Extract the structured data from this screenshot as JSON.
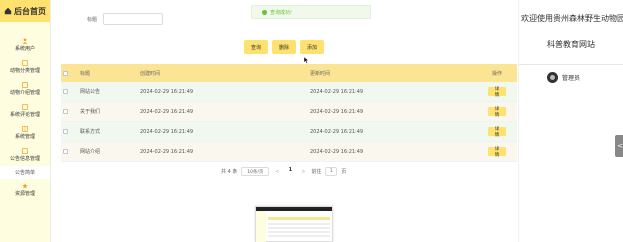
{
  "sidebar": {
    "brand": "后台首页",
    "items": [
      {
        "label": "系统用户",
        "icon": "user-icon"
      },
      {
        "label": "动物分类管理",
        "icon": "edit-icon"
      },
      {
        "label": "动物介绍管理",
        "icon": "edit-icon"
      },
      {
        "label": "系统评论管理",
        "icon": "edit-icon"
      },
      {
        "label": "系统管理",
        "icon": "grid-icon"
      },
      {
        "label": "公告信息管理",
        "icon": "edit-icon"
      }
    ],
    "sub_item": "公告简单",
    "last_item": {
      "label": "资源管理",
      "icon": "star-icon"
    }
  },
  "search": {
    "label": "标题",
    "value": ""
  },
  "toast": {
    "message": "查询成功!"
  },
  "actions": {
    "query": "查询",
    "delete": "删除",
    "add": "添加"
  },
  "table": {
    "headers": {
      "title": "标题",
      "t1": "创建时间",
      "t2": "更新时间",
      "op": "操作"
    },
    "rows": [
      {
        "title": "网站公告",
        "t1": "2024-02-29 16:21:49",
        "t2": "2024-02-29 16:21:49",
        "op": "详情"
      },
      {
        "title": "关于我们",
        "t1": "2024-02-29 16:21:49",
        "t2": "2024-02-29 16:21:49",
        "op": "详情"
      },
      {
        "title": "联系方式",
        "t1": "2024-02-29 16:21:49",
        "t2": "2024-02-29 16:21:49",
        "op": "详情"
      },
      {
        "title": "网站介绍",
        "t1": "2024-02-29 16:21:49",
        "t2": "2024-02-29 16:21:49",
        "op": "详情"
      }
    ]
  },
  "pagination": {
    "total": "共 4 条",
    "page_size": "10条/页",
    "prev": "<",
    "current": "1",
    "next": ">",
    "goto_label": "前往",
    "goto_value": "1",
    "page_unit": "页"
  },
  "right_panel": {
    "welcome_line1": "欢迎使用贵州森林野生动物园",
    "welcome_line2": "科普教育网站",
    "user": "管理员",
    "collapse": "<"
  },
  "colors": {
    "accent": "#ffe16f",
    "header_row": "#fbe493",
    "sidebar_bg": "#fffde0",
    "toast_bg": "#f0f9eb",
    "toast_text": "#67c23a"
  }
}
